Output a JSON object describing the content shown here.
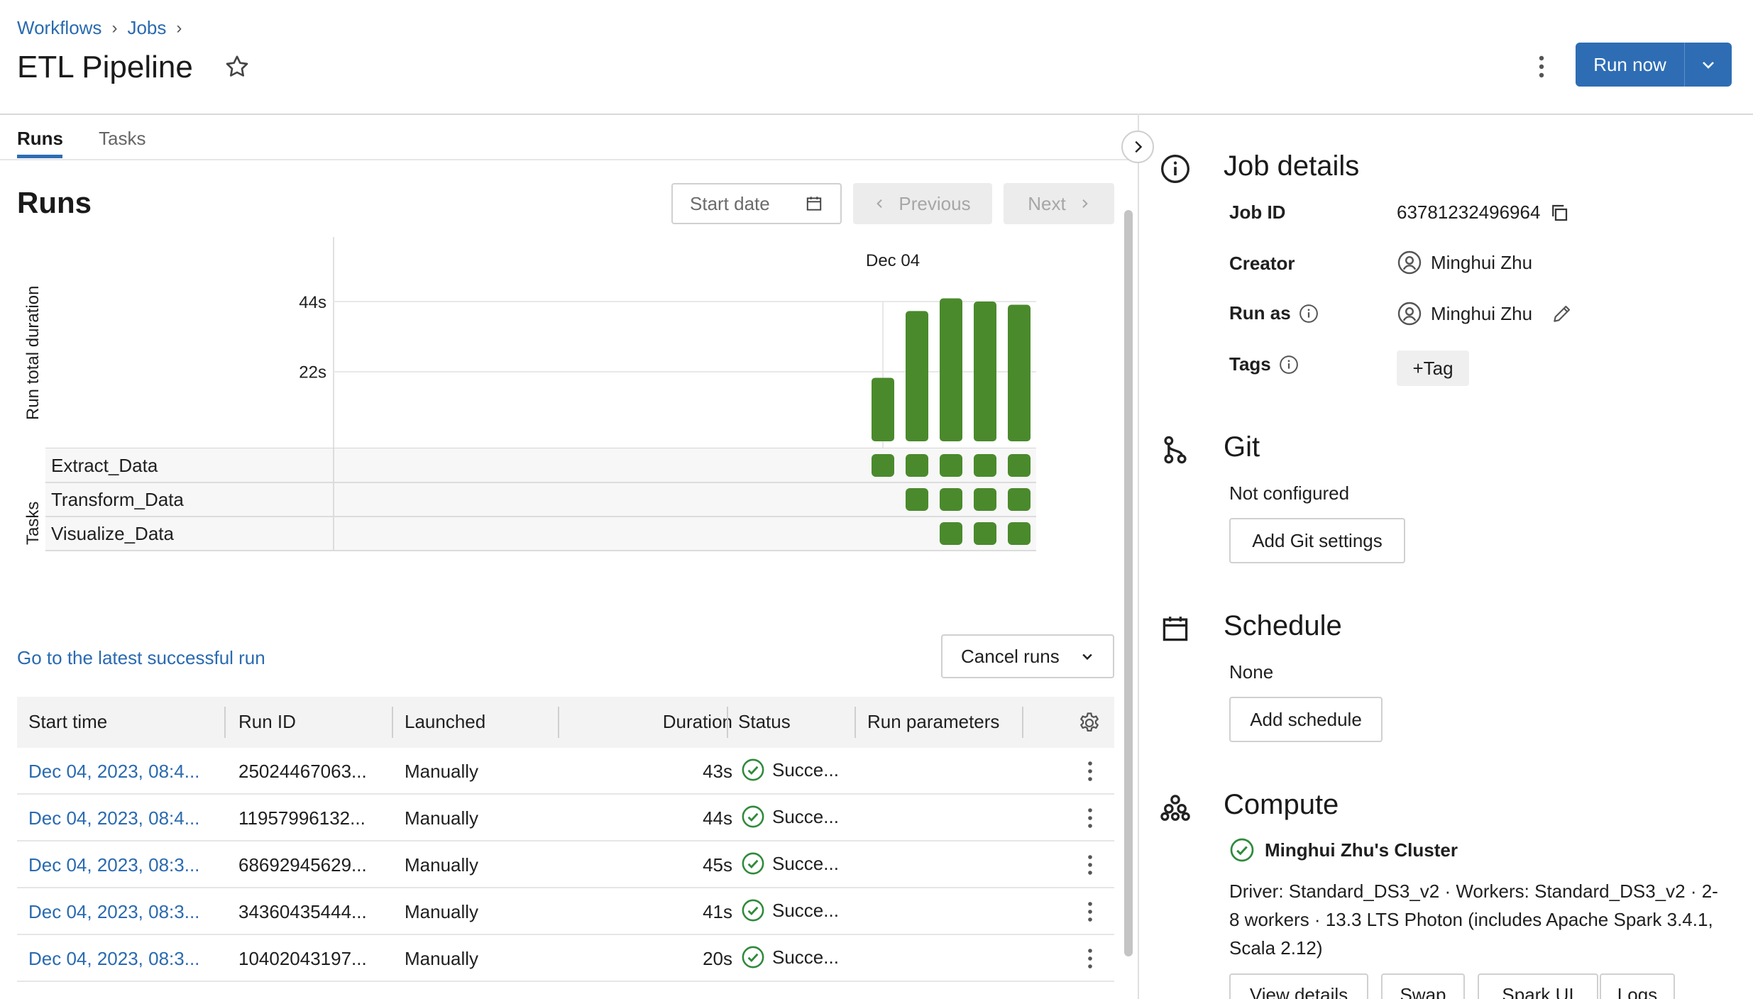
{
  "breadcrumb": [
    "Workflows",
    "Jobs"
  ],
  "page_title": "ETL Pipeline",
  "header": {
    "run_now_label": "Run now"
  },
  "tabs": [
    {
      "label": "Runs",
      "active": true
    },
    {
      "label": "Tasks",
      "active": false
    }
  ],
  "runs": {
    "heading": "Runs",
    "start_date_placeholder": "Start date",
    "previous_label": "Previous",
    "next_label": "Next",
    "latest_link": "Go to the latest successful run",
    "cancel_label": "Cancel runs"
  },
  "chart_data": {
    "type": "bar",
    "date_label": "Dec 04",
    "ylabel": "Run total duration",
    "ytick_labels": [
      "44s",
      "22s"
    ],
    "yticks": [
      44,
      22
    ],
    "values": [
      20,
      41,
      45,
      44,
      43
    ],
    "bar_color": "#4a8a2c",
    "task_axis_label": "Tasks",
    "tasks": [
      {
        "name": "Extract_Data",
        "runs": [
          true,
          true,
          true,
          true,
          true
        ]
      },
      {
        "name": "Transform_Data",
        "runs": [
          false,
          true,
          true,
          true,
          true
        ]
      },
      {
        "name": "Visualize_Data",
        "runs": [
          false,
          false,
          true,
          true,
          true
        ]
      }
    ]
  },
  "table": {
    "columns": [
      "Start time",
      "Run ID",
      "Launched",
      "Duration",
      "Status",
      "Run parameters"
    ],
    "rows": [
      {
        "start": "Dec 04, 2023, 08:4...",
        "id": "25024467063...",
        "launched": "Manually",
        "duration": "43s",
        "status": "Succe..."
      },
      {
        "start": "Dec 04, 2023, 08:4...",
        "id": "11957996132...",
        "launched": "Manually",
        "duration": "44s",
        "status": "Succe..."
      },
      {
        "start": "Dec 04, 2023, 08:3...",
        "id": "68692945629...",
        "launched": "Manually",
        "duration": "45s",
        "status": "Succe..."
      },
      {
        "start": "Dec 04, 2023, 08:3...",
        "id": "34360435444...",
        "launched": "Manually",
        "duration": "41s",
        "status": "Succe..."
      },
      {
        "start": "Dec 04, 2023, 08:3...",
        "id": "10402043197...",
        "launched": "Manually",
        "duration": "20s",
        "status": "Succe..."
      }
    ]
  },
  "job_details": {
    "title": "Job details",
    "job_id_label": "Job ID",
    "job_id": "63781232496964",
    "creator_label": "Creator",
    "creator": "Minghui Zhu",
    "run_as_label": "Run as",
    "run_as": "Minghui Zhu",
    "tags_label": "Tags",
    "tag_button": "+Tag"
  },
  "git": {
    "title": "Git",
    "status": "Not configured",
    "button": "Add Git settings"
  },
  "schedule": {
    "title": "Schedule",
    "status": "None",
    "button": "Add schedule"
  },
  "compute": {
    "title": "Compute",
    "cluster_name": "Minghui Zhu's Cluster",
    "description": "Driver: Standard_DS3_v2 · Workers: Standard_DS3_v2 · 2-8 workers · 13.3 LTS Photon (includes Apache Spark 3.4.1, Scala 2.12)",
    "buttons": [
      "View details",
      "Swap",
      "Spark UI",
      "Logs"
    ]
  },
  "colors": {
    "accent": "#2e6db4",
    "link": "#2a6ab0",
    "success": "#2f8a3c",
    "bar": "#4a8a2c"
  }
}
